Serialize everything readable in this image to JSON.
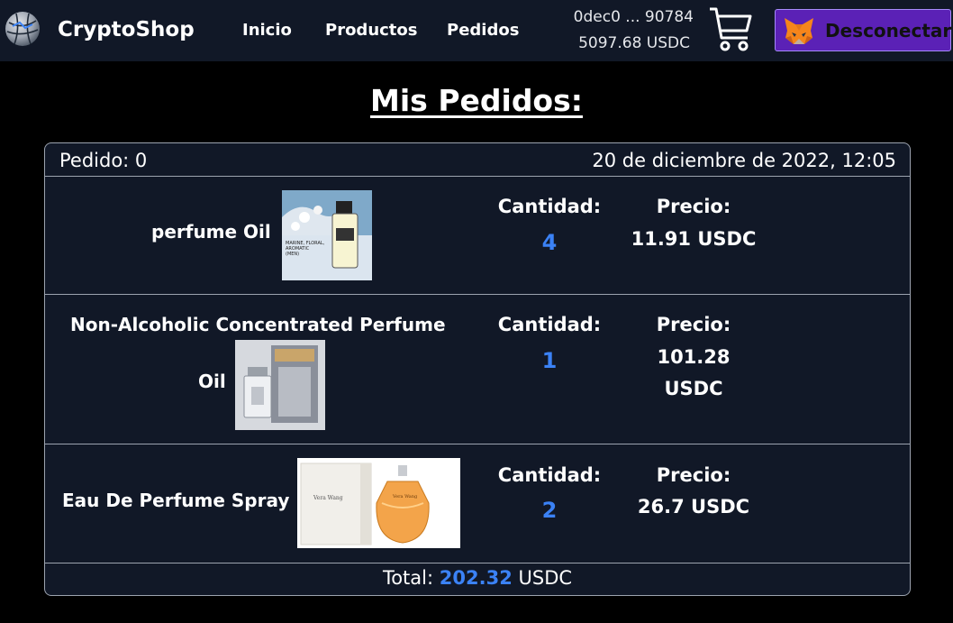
{
  "navbar": {
    "brand": "CryptoShop",
    "links": [
      "Inicio",
      "Productos",
      "Pedidos"
    ],
    "wallet_address": "0dec0 ... 90784",
    "wallet_balance": "5097.68 USDC",
    "disconnect_label": "Desconectar",
    "icons": {
      "logo": "globe-logo-icon",
      "cart": "shopping-cart-icon",
      "wallet": "metamask-fox-icon"
    },
    "colors": {
      "background": "#111827",
      "button": "#5b21b6"
    }
  },
  "page": {
    "title": "Mis Pedidos:"
  },
  "order": {
    "id_label": "Pedido: 0",
    "date": "20 de diciembre de 2022, 12:05",
    "quantity_label": "Cantidad:",
    "price_label": "Precio:",
    "items": [
      {
        "name": "perfume Oil",
        "quantity": "4",
        "price_line1": "11.91 USDC",
        "price_line2": "",
        "image_text": "MARINE, FLORAL, AROMATIC (MEN)"
      },
      {
        "name_line1": "Non-Alcoholic Concentrated Perfume",
        "name_line2": "Oil",
        "quantity": "1",
        "price_line1": "101.28",
        "price_line2": "USDC"
      },
      {
        "name": "Eau De Perfume Spray",
        "quantity": "2",
        "price_line1": "26.7 USDC",
        "price_line2": ""
      }
    ],
    "total_label": "Total:",
    "total_amount": "202.32",
    "total_currency": "USDC",
    "accent_color": "#3b82f6"
  }
}
